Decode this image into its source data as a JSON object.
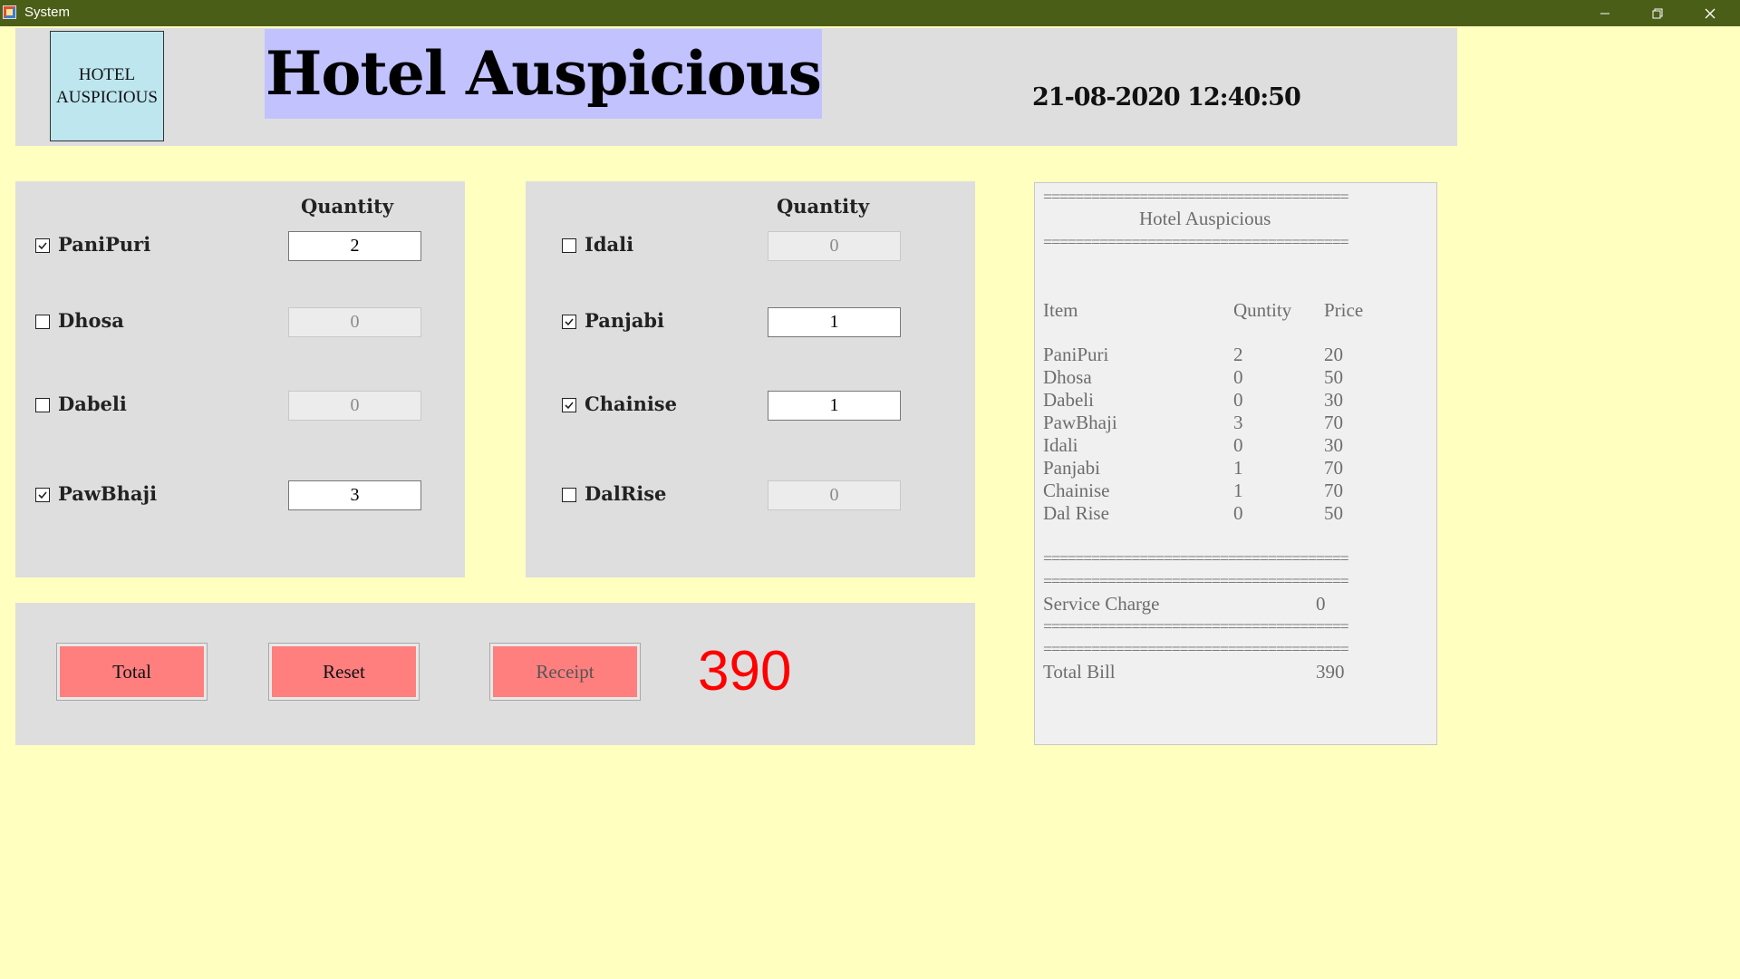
{
  "window": {
    "title": "System"
  },
  "header": {
    "logo_line1": "HOTEL",
    "logo_line2": "AUSPICIOUS",
    "hotel_name": "Hotel Auspicious",
    "datetime": "21-08-2020 12:40:50"
  },
  "menu": {
    "quantity_header": "Quantity",
    "left_items": [
      {
        "label": "PaniPuri",
        "checked": true,
        "qty": "2"
      },
      {
        "label": "Dhosa",
        "checked": false,
        "qty": "0"
      },
      {
        "label": "Dabeli",
        "checked": false,
        "qty": "0"
      },
      {
        "label": "PawBhaji",
        "checked": true,
        "qty": "3"
      }
    ],
    "right_items": [
      {
        "label": "Idali",
        "checked": false,
        "qty": "0"
      },
      {
        "label": "Panjabi",
        "checked": true,
        "qty": "1"
      },
      {
        "label": "Chainise",
        "checked": true,
        "qty": "1"
      },
      {
        "label": "DalRise",
        "checked": false,
        "qty": "0"
      }
    ]
  },
  "actions": {
    "total_label": "Total",
    "reset_label": "Reset",
    "receipt_label": "Receipt",
    "total_value": "390"
  },
  "receipt": {
    "separator": "======================================",
    "title": "Hotel Auspicious",
    "col_item": "Item",
    "col_qty": "Quntity",
    "col_price": "Price",
    "rows": [
      {
        "item": "PaniPuri",
        "qty": "2",
        "price": "20"
      },
      {
        "item": "Dhosa",
        "qty": "0",
        "price": "50"
      },
      {
        "item": "Dabeli",
        "qty": "0",
        "price": "30"
      },
      {
        "item": "PawBhaji",
        "qty": "3",
        "price": "70"
      },
      {
        "item": "Idali",
        "qty": "0",
        "price": "30"
      },
      {
        "item": "Panjabi",
        "qty": "1",
        "price": "70"
      },
      {
        "item": "Chainise",
        "qty": "1",
        "price": "70"
      },
      {
        "item": "Dal Rise",
        "qty": "0",
        "price": "50"
      }
    ],
    "service_charge_label": "Service Charge",
    "service_charge_value": "0",
    "total_bill_label": "Total Bill",
    "total_bill_value": "390"
  },
  "colors": {
    "titlebar": "#4b5e18",
    "background": "#ffffc0",
    "title_bg": "#c2c2ff",
    "button": "#ff7f7f",
    "total_text": "#ff0000"
  }
}
